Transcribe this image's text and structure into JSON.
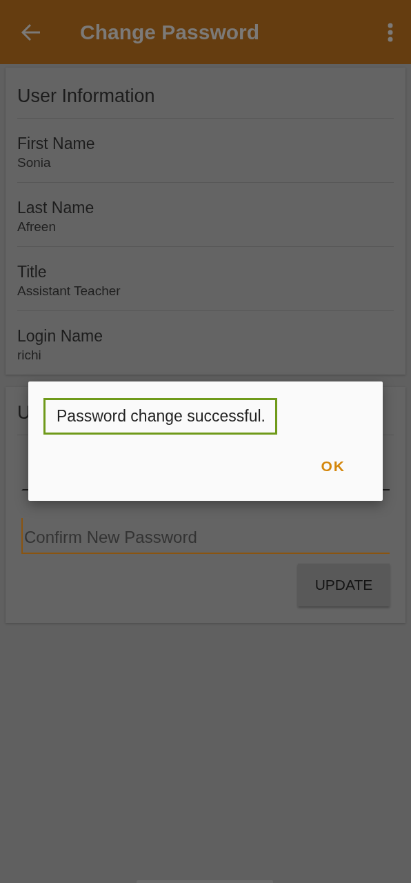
{
  "app_bar": {
    "title": "Change Password"
  },
  "user_information": {
    "title": "User Information",
    "fields": [
      {
        "label": "First Name",
        "value": "Sonia"
      },
      {
        "label": "Last Name",
        "value": "Afreen"
      },
      {
        "label": "Title",
        "value": "Assistant Teacher"
      },
      {
        "label": "Login Name",
        "value": "richi"
      }
    ]
  },
  "update_card": {
    "title": "U",
    "fields": [
      {
        "focused": false
      },
      {
        "placeholder": "Confirm New Password",
        "focused": true
      }
    ],
    "button": "UPDATE"
  },
  "dialog": {
    "message": "Password change successful.",
    "button": "OK"
  }
}
